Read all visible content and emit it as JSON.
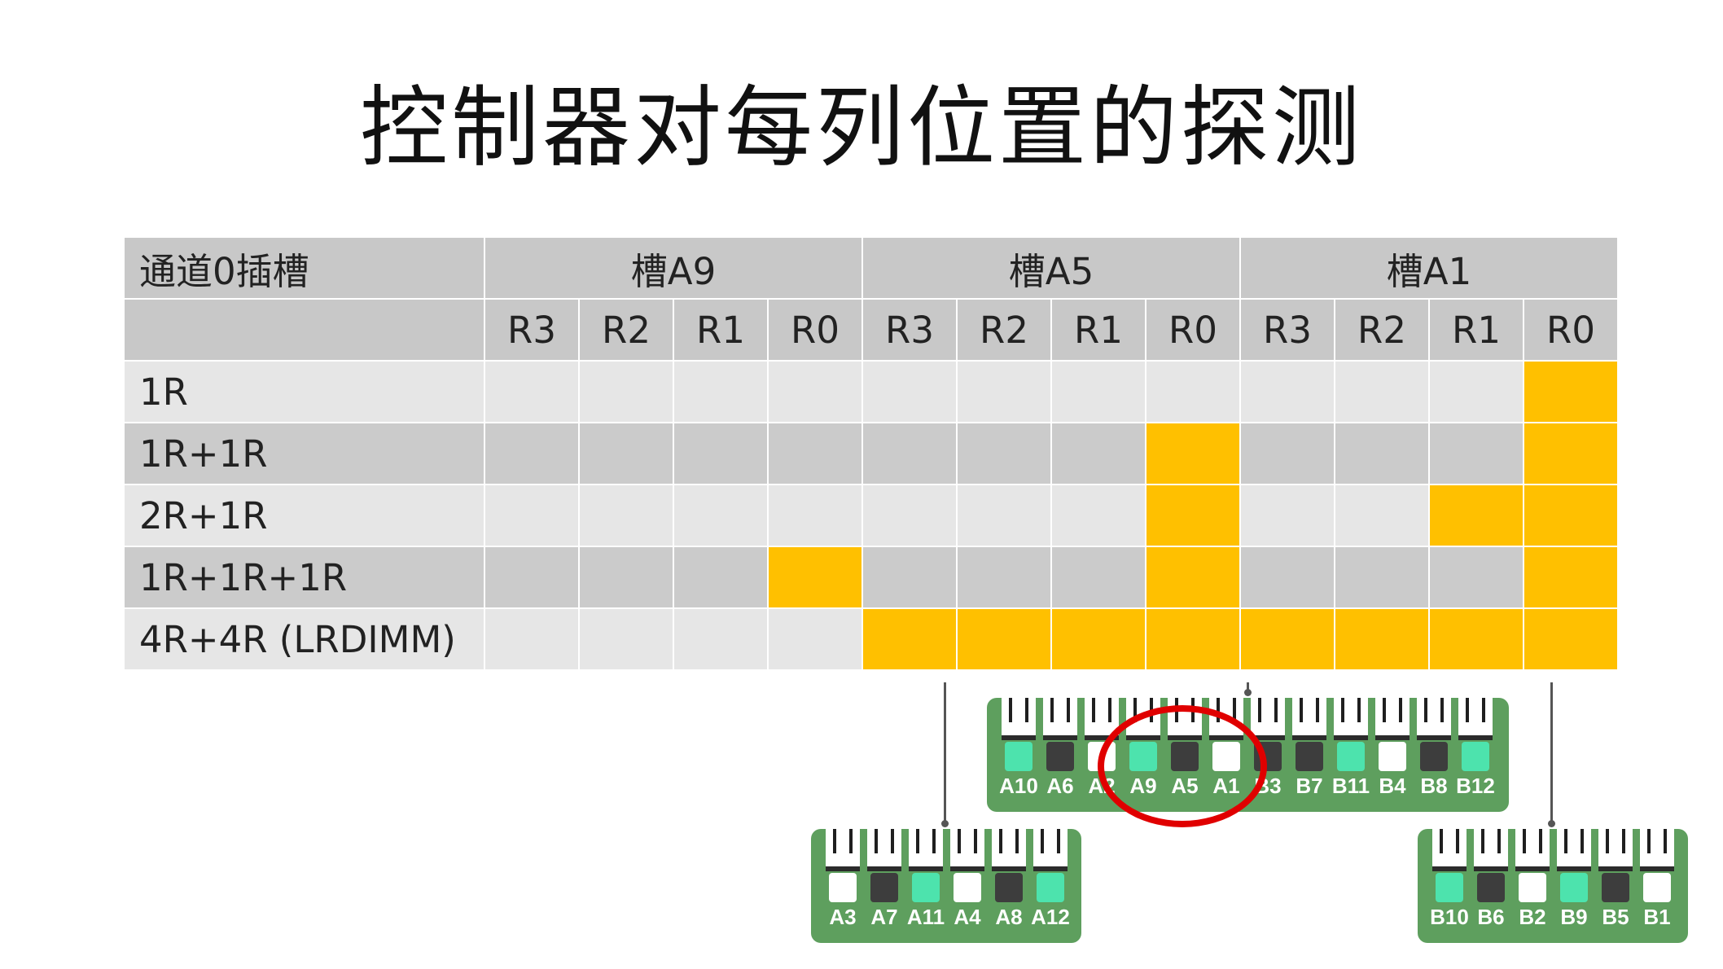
{
  "title": "控制器对每列位置的探测",
  "table": {
    "corner_label": "通道0插槽",
    "slots": [
      "槽A9",
      "槽A5",
      "槽A1"
    ],
    "ranks": [
      "R3",
      "R2",
      "R1",
      "R0",
      "R3",
      "R2",
      "R1",
      "R0",
      "R3",
      "R2",
      "R1",
      "R0"
    ],
    "rows": [
      {
        "label": "1R",
        "active": [
          0,
          0,
          0,
          0,
          0,
          0,
          0,
          0,
          0,
          0,
          0,
          1
        ]
      },
      {
        "label": "1R+1R",
        "active": [
          0,
          0,
          0,
          0,
          0,
          0,
          0,
          1,
          0,
          0,
          0,
          1
        ]
      },
      {
        "label": "2R+1R",
        "active": [
          0,
          0,
          0,
          0,
          0,
          0,
          0,
          1,
          0,
          0,
          1,
          1
        ]
      },
      {
        "label": "1R+1R+1R",
        "active": [
          0,
          0,
          0,
          1,
          0,
          0,
          0,
          1,
          0,
          0,
          0,
          1
        ]
      },
      {
        "label": "4R+4R (LRDIMM)",
        "active": [
          0,
          0,
          0,
          0,
          1,
          1,
          1,
          1,
          1,
          1,
          1,
          1
        ]
      }
    ]
  },
  "colors": {
    "active_cell": "#ffc000",
    "header_bg": "#c8c8c8",
    "row_light": "#e6e6e6",
    "row_dark": "#cbcbcb",
    "board_green": "#5e9f5e",
    "slot_teal": "#4de3ad",
    "slot_dark": "#3d3d3d",
    "highlight_ring": "#e00000"
  },
  "boards": [
    {
      "name": "center",
      "slots": [
        {
          "label": "A10",
          "color": "teal"
        },
        {
          "label": "A6",
          "color": "dark"
        },
        {
          "label": "A2",
          "color": "white"
        },
        {
          "label": "A9",
          "color": "teal"
        },
        {
          "label": "A5",
          "color": "dark"
        },
        {
          "label": "A1",
          "color": "white"
        },
        {
          "label": "B3",
          "color": "dark"
        },
        {
          "label": "B7",
          "color": "dark"
        },
        {
          "label": "B11",
          "color": "teal"
        },
        {
          "label": "B4",
          "color": "white"
        },
        {
          "label": "B8",
          "color": "dark"
        },
        {
          "label": "B12",
          "color": "teal"
        }
      ]
    },
    {
      "name": "left",
      "slots": [
        {
          "label": "A3",
          "color": "white"
        },
        {
          "label": "A7",
          "color": "dark"
        },
        {
          "label": "A11",
          "color": "teal"
        },
        {
          "label": "A4",
          "color": "white"
        },
        {
          "label": "A8",
          "color": "dark"
        },
        {
          "label": "A12",
          "color": "teal"
        }
      ]
    },
    {
      "name": "right",
      "slots": [
        {
          "label": "B10",
          "color": "teal"
        },
        {
          "label": "B6",
          "color": "dark"
        },
        {
          "label": "B2",
          "color": "white"
        },
        {
          "label": "B9",
          "color": "teal"
        },
        {
          "label": "B5",
          "color": "dark"
        },
        {
          "label": "B1",
          "color": "white"
        }
      ]
    }
  ]
}
